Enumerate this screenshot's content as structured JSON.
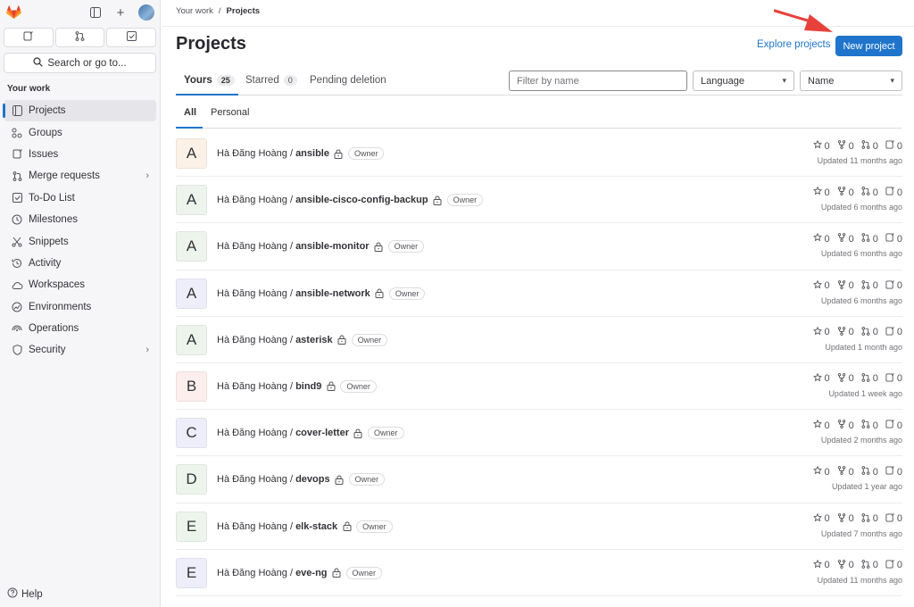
{
  "sidebar": {
    "section_title": "Your work",
    "search_label": "Search or go to...",
    "items": [
      {
        "label": "Projects",
        "icon": "project-icon"
      },
      {
        "label": "Groups",
        "icon": "group-icon"
      },
      {
        "label": "Issues",
        "icon": "issues-icon"
      },
      {
        "label": "Merge requests",
        "icon": "merge-request-icon"
      },
      {
        "label": "To-Do List",
        "icon": "todo-icon"
      },
      {
        "label": "Milestones",
        "icon": "milestone-icon"
      },
      {
        "label": "Snippets",
        "icon": "snippet-icon"
      },
      {
        "label": "Activity",
        "icon": "history-icon"
      },
      {
        "label": "Workspaces",
        "icon": "cloud-icon"
      },
      {
        "label": "Environments",
        "icon": "environment-icon"
      },
      {
        "label": "Operations",
        "icon": "operations-icon"
      },
      {
        "label": "Security",
        "icon": "shield-icon"
      }
    ],
    "help_label": "Help"
  },
  "breadcrumb": {
    "parent": "Your work",
    "separator": "/",
    "current": "Projects"
  },
  "page": {
    "title": "Projects",
    "explore_label": "Explore projects",
    "new_project_label": "New project"
  },
  "tabs": {
    "yours": {
      "label": "Yours",
      "count": "25"
    },
    "starred": {
      "label": "Starred",
      "count": "0"
    },
    "pending": {
      "label": "Pending deletion"
    }
  },
  "filters": {
    "filter_placeholder": "Filter by name",
    "language_label": "Language",
    "sort_label": "Name"
  },
  "subtabs": {
    "all": "All",
    "personal": "Personal"
  },
  "colors": {
    "accent": "#1f75cb",
    "arrow": "#e8413b"
  },
  "projects": [
    {
      "initial": "A",
      "owner": "Hà Đăng Hoàng / ",
      "name": "ansible",
      "role": "Owner",
      "stars": "0",
      "forks": "0",
      "mrs": "0",
      "issues": "0",
      "updated": "Updated 11 months ago",
      "bg": "#fcf1e6"
    },
    {
      "initial": "A",
      "owner": "Hà Đăng Hoàng / ",
      "name": "ansible-cisco-config-backup",
      "role": "Owner",
      "stars": "0",
      "forks": "0",
      "mrs": "0",
      "issues": "0",
      "updated": "Updated 6 months ago",
      "bg": "#ecf4ec"
    },
    {
      "initial": "A",
      "owner": "Hà Đăng Hoàng / ",
      "name": "ansible-monitor",
      "role": "Owner",
      "stars": "0",
      "forks": "0",
      "mrs": "0",
      "issues": "0",
      "updated": "Updated 6 months ago",
      "bg": "#ecf4ec"
    },
    {
      "initial": "A",
      "owner": "Hà Đăng Hoàng / ",
      "name": "ansible-network",
      "role": "Owner",
      "stars": "0",
      "forks": "0",
      "mrs": "0",
      "issues": "0",
      "updated": "Updated 6 months ago",
      "bg": "#eeeefb"
    },
    {
      "initial": "A",
      "owner": "Hà Đăng Hoàng / ",
      "name": "asterisk",
      "role": "Owner",
      "stars": "0",
      "forks": "0",
      "mrs": "0",
      "issues": "0",
      "updated": "Updated 1 month ago",
      "bg": "#ecf4ec"
    },
    {
      "initial": "B",
      "owner": "Hà Đăng Hoàng / ",
      "name": "bind9",
      "role": "Owner",
      "stars": "0",
      "forks": "0",
      "mrs": "0",
      "issues": "0",
      "updated": "Updated 1 week ago",
      "bg": "#fbeeec"
    },
    {
      "initial": "C",
      "owner": "Hà Đăng Hoàng / ",
      "name": "cover-letter",
      "role": "Owner",
      "stars": "0",
      "forks": "0",
      "mrs": "0",
      "issues": "0",
      "updated": "Updated 2 months ago",
      "bg": "#eeeefb"
    },
    {
      "initial": "D",
      "owner": "Hà Đăng Hoàng / ",
      "name": "devops",
      "role": "Owner",
      "stars": "0",
      "forks": "0",
      "mrs": "0",
      "issues": "0",
      "updated": "Updated 1 year ago",
      "bg": "#ecf4ec"
    },
    {
      "initial": "E",
      "owner": "Hà Đăng Hoàng / ",
      "name": "elk-stack",
      "role": "Owner",
      "stars": "0",
      "forks": "0",
      "mrs": "0",
      "issues": "0",
      "updated": "Updated 7 months ago",
      "bg": "#ecf4ec"
    },
    {
      "initial": "E",
      "owner": "Hà Đăng Hoàng / ",
      "name": "eve-ng",
      "role": "Owner",
      "stars": "0",
      "forks": "0",
      "mrs": "0",
      "issues": "0",
      "updated": "Updated 11 months ago",
      "bg": "#eeeefb"
    }
  ]
}
